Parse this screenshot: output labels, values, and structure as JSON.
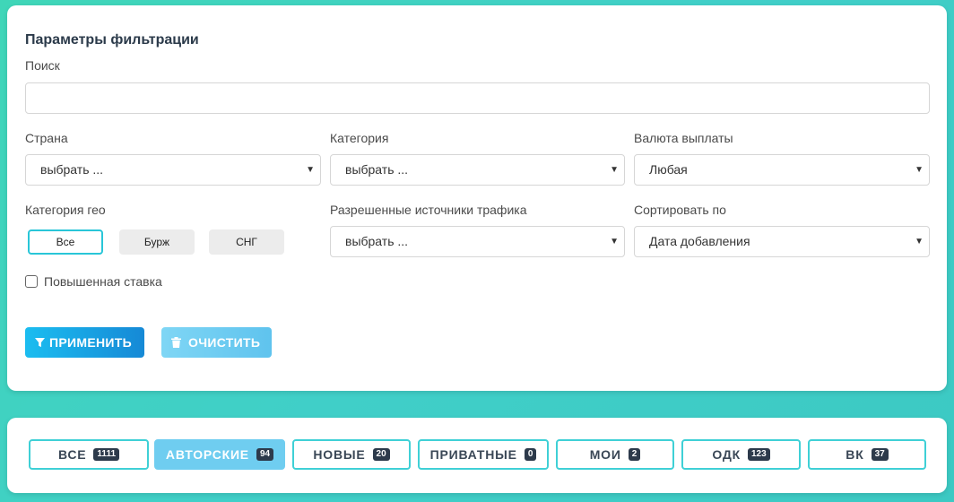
{
  "filter": {
    "title": "Параметры фильтрации",
    "search_label": "Поиск",
    "search_value": "",
    "country": {
      "label": "Страна",
      "value": "выбрать ..."
    },
    "category": {
      "label": "Категория",
      "value": "выбрать ..."
    },
    "currency": {
      "label": "Валюта выплаты",
      "value": "Любая"
    },
    "geo": {
      "label": "Категория гео",
      "options": [
        "Все",
        "Бурж",
        "СНГ"
      ],
      "selected": "Все"
    },
    "traffic": {
      "label": "Разрешенные источники трафика",
      "value": "выбрать ..."
    },
    "sort": {
      "label": "Сортировать по",
      "value": "Дата добавления"
    },
    "raised_rate": {
      "label": "Повышенная ставка",
      "checked": false
    },
    "apply_label": "ПРИМЕНИТЬ",
    "clear_label": "ОЧИСТИТЬ",
    "arrow_glyph": "▼",
    "apply_icon": "filter-icon",
    "clear_icon": "trash-icon"
  },
  "tabs": [
    {
      "label": "ВСЕ",
      "count": "1111",
      "active": false
    },
    {
      "label": "АВТОРСКИЕ",
      "count": "94",
      "active": true
    },
    {
      "label": "НОВЫЕ",
      "count": "20",
      "active": false
    },
    {
      "label": "ПРИВАТНЫЕ",
      "count": "0",
      "active": false
    },
    {
      "label": "МОИ",
      "count": "2",
      "active": false
    },
    {
      "label": "ОДК",
      "count": "123",
      "active": false
    },
    {
      "label": "ВК",
      "count": "37",
      "active": false
    }
  ],
  "colors": {
    "accent": "#29c6d8",
    "tab_border": "#3fd0d6",
    "tab_active": "#6fcdf0",
    "badge": "#2d3a4b"
  }
}
